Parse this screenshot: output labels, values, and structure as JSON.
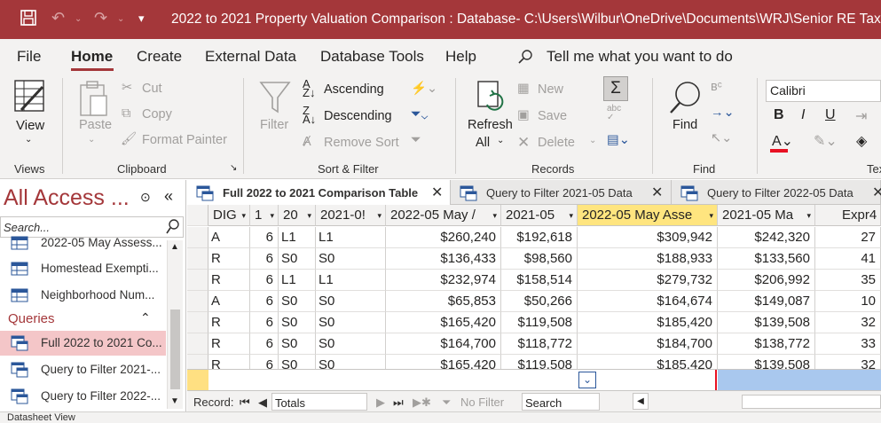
{
  "window": {
    "title": "2022 to 2021 Property Valuation Comparison : Database- C:\\Users\\Wilbur\\OneDrive\\Documents\\WRJ\\Senior RE Tax..."
  },
  "ribbon_tabs": [
    "File",
    "Home",
    "Create",
    "External Data",
    "Database Tools",
    "Help"
  ],
  "tell_me": "Tell me what you want to do",
  "ribbon": {
    "views": {
      "view": "View",
      "group": "Views"
    },
    "clipboard": {
      "paste": "Paste",
      "cut": "Cut",
      "copy": "Copy",
      "format_painter": "Format Painter",
      "group": "Clipboard"
    },
    "sort_filter": {
      "filter": "Filter",
      "ascending": "Ascending",
      "descending": "Descending",
      "remove_sort": "Remove Sort",
      "group": "Sort & Filter"
    },
    "records": {
      "refresh": "Refresh",
      "refresh_all": "All",
      "new": "New",
      "save": "Save",
      "delete": "Delete",
      "group": "Records"
    },
    "find": {
      "find": "Find",
      "group": "Find"
    },
    "text_formatting": {
      "font": "Calibri",
      "bold": "B",
      "italic": "I",
      "underline": "U",
      "group": "Tex"
    }
  },
  "nav_pane": {
    "title": "All Access ...",
    "search_placeholder": "Search...",
    "items_top": [
      "2022-05 May Assess...",
      "Homestead Exempti...",
      "Neighborhood Num..."
    ],
    "queries_header": "Queries",
    "queries": [
      "Full 2022 to 2021 Co...",
      "Query to Filter 2021-...",
      "Query to Filter 2022-..."
    ]
  },
  "doc_tabs": [
    "Full 2022 to 2021 Comparison Table",
    "Query to Filter 2021-05 Data",
    "Query to Filter 2022-05 Data"
  ],
  "grid": {
    "columns": [
      "DIG",
      "1",
      "20",
      "2021-0!",
      "2022-05 May /",
      "2021-05",
      "2022-05 May Asse",
      "2021-05 Ma",
      "Expr4"
    ],
    "rows": [
      [
        "A",
        "6",
        "L1",
        "L1",
        "$260,240",
        "$192,618",
        "$309,942",
        "$242,320",
        "27"
      ],
      [
        "R",
        "6",
        "S0",
        "S0",
        "$136,433",
        "$98,560",
        "$188,933",
        "$133,560",
        "41"
      ],
      [
        "R",
        "6",
        "L1",
        "L1",
        "$232,974",
        "$158,514",
        "$279,732",
        "$206,992",
        "35"
      ],
      [
        "A",
        "6",
        "S0",
        "S0",
        "$65,853",
        "$50,266",
        "$164,674",
        "$149,087",
        "10"
      ],
      [
        "R",
        "6",
        "S0",
        "S0",
        "$165,420",
        "$119,508",
        "$185,420",
        "$139,508",
        "32"
      ],
      [
        "R",
        "6",
        "S0",
        "S0",
        "$164,700",
        "$118,772",
        "$184,700",
        "$138,772",
        "33"
      ],
      [
        "R",
        "6",
        "S0",
        "S0",
        "$165,420",
        "$119,508",
        "$185,420",
        "$139,508",
        "32"
      ]
    ]
  },
  "record_nav": {
    "label": "Record:",
    "position": "Totals",
    "no_filter": "No Filter",
    "search": "Search"
  },
  "status": "Datasheet View",
  "colors": {
    "accent": "#a4373a",
    "selected_header": "#ffe57f",
    "selected_nav": "#f4c6c8"
  }
}
